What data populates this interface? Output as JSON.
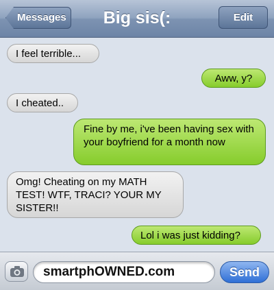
{
  "navbar": {
    "title": "Big sis(:",
    "back_label": "Messages",
    "edit_label": "Edit"
  },
  "messages": [
    {
      "side": "left",
      "text": "I feel terrible..."
    },
    {
      "side": "right",
      "text": "Aww, y?"
    },
    {
      "side": "left",
      "text": "I cheated.."
    },
    {
      "side": "right",
      "text": "Fine by me, i've been having sex with your boyfriend for a month now"
    },
    {
      "side": "left",
      "text": "Omg! Cheating on my MATH TEST! WTF, TRACI? YOUR MY SISTER!!"
    },
    {
      "side": "right",
      "text": "Lol i was just kidding?"
    }
  ],
  "compose": {
    "value": "smartphOWNED.com",
    "send_label": "Send",
    "camera_icon": "camera-icon"
  },
  "colors": {
    "outgoing_bubble": "#8fd13a",
    "incoming_bubble": "#e6e6e6",
    "navbar": "#7d93b2",
    "send_button": "#2f6fd6"
  }
}
